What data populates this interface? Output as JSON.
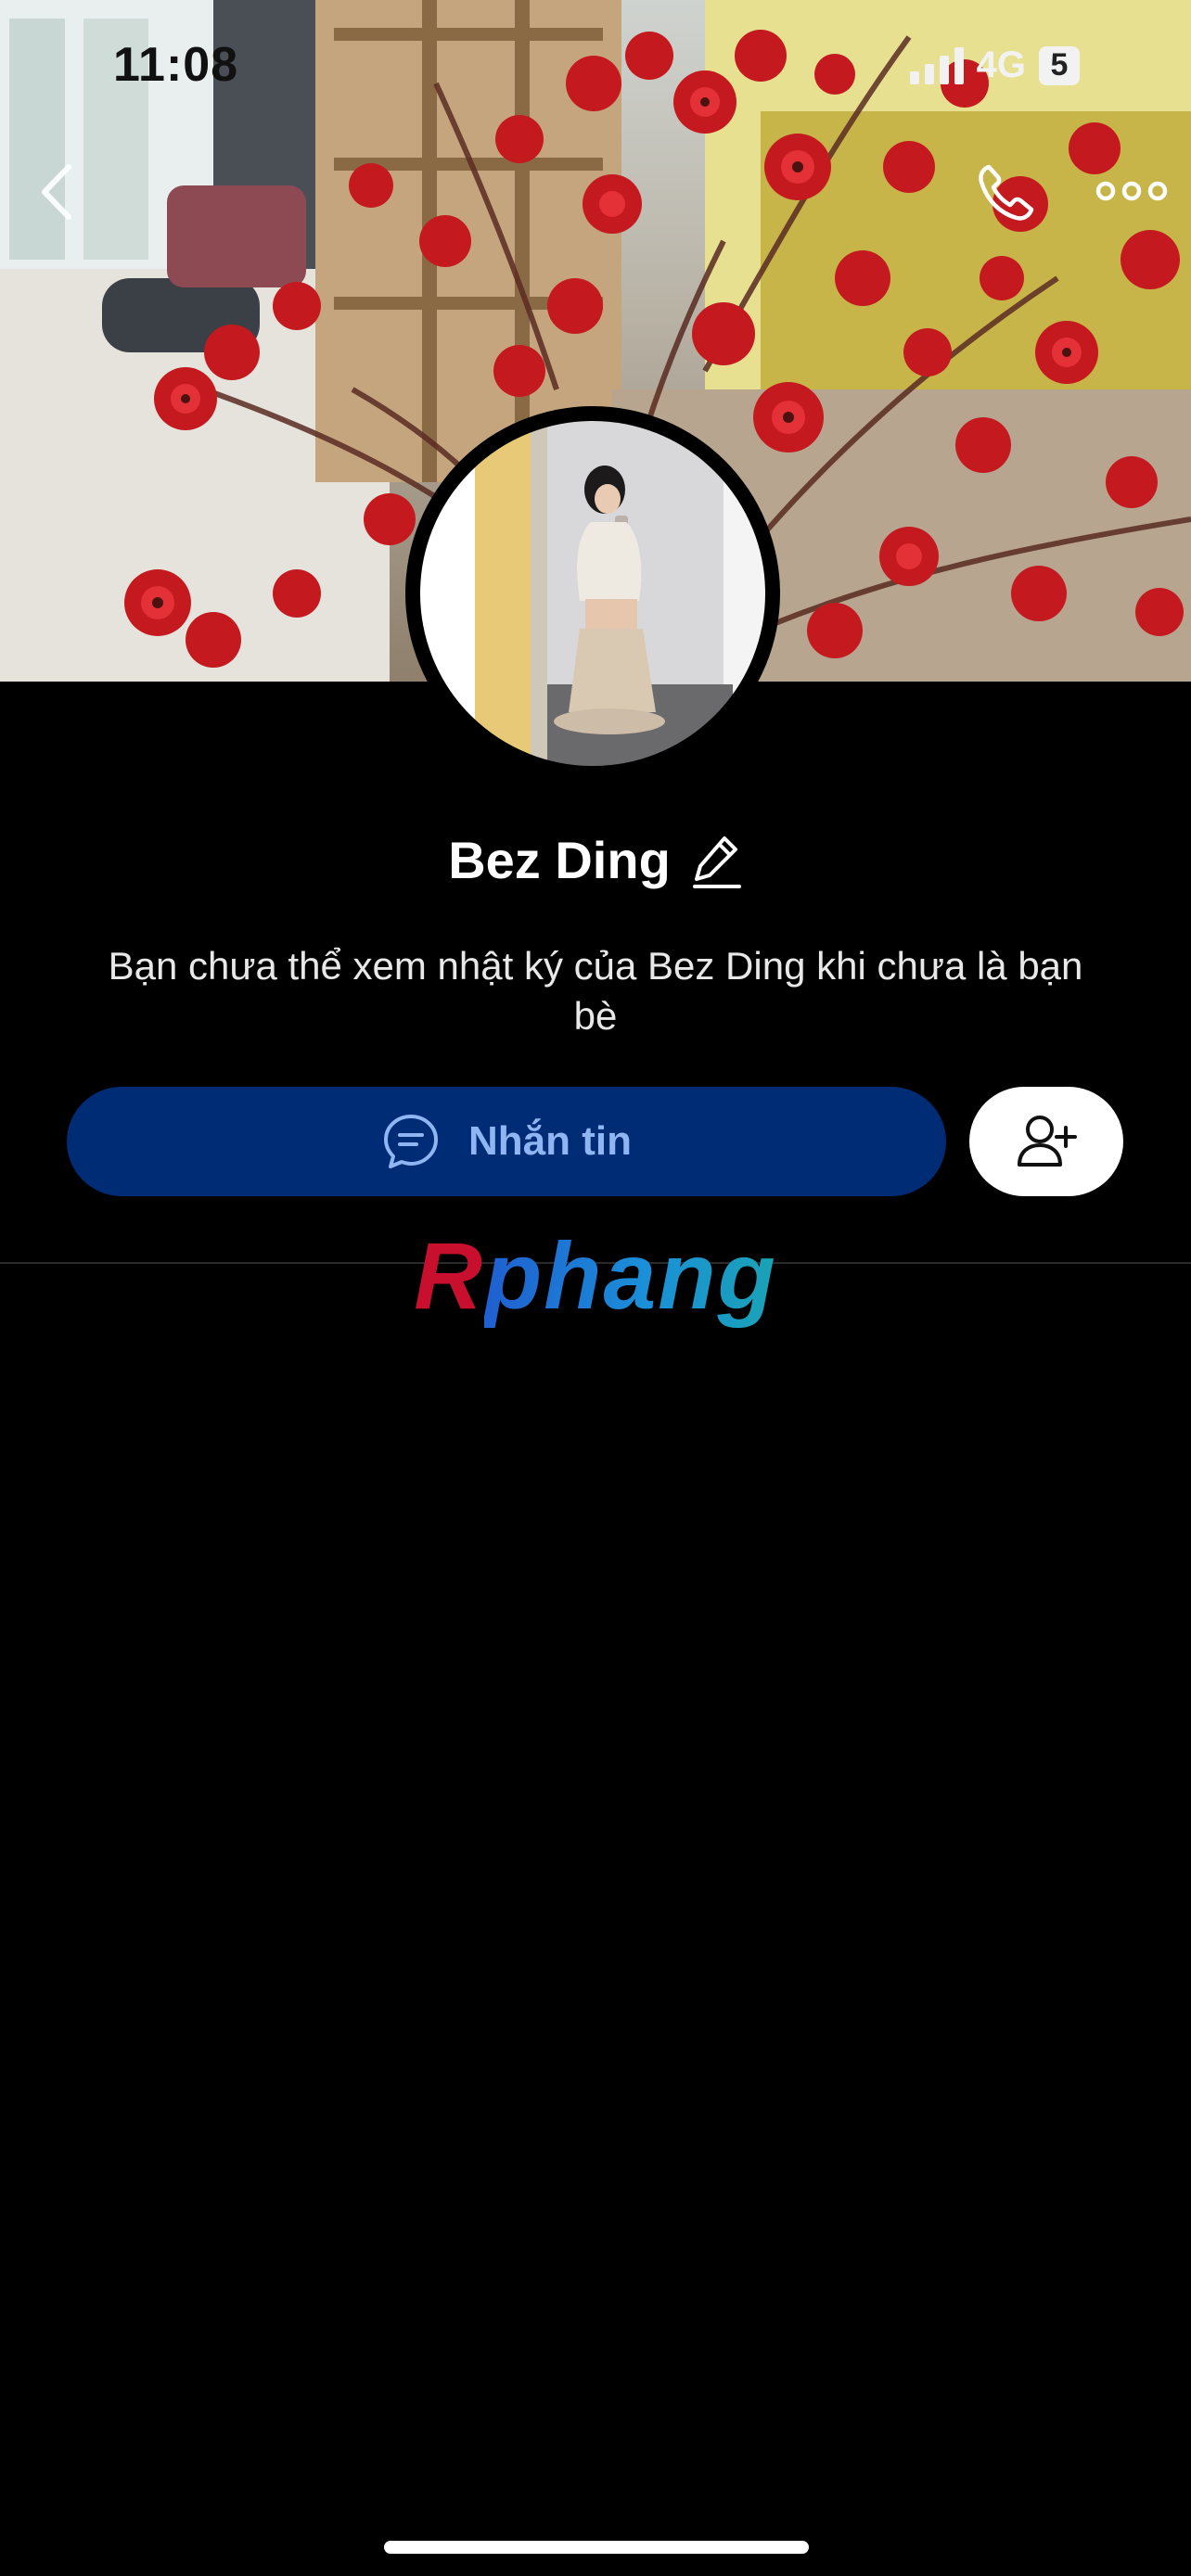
{
  "status_bar": {
    "time": "11:08",
    "network": "4G",
    "battery": "5"
  },
  "profile": {
    "name": "Bez Ding",
    "privacy_note": "Bạn chưa thể xem nhật ký của Bez Ding khi chưa là bạn bè"
  },
  "actions": {
    "message_label": "Nhắn tin"
  },
  "watermark": {
    "first_letter": "R",
    "rest": "phang"
  },
  "icons": {
    "back": "chevron-left-icon",
    "call": "phone-icon",
    "more": "more-dots-icon",
    "edit": "pencil-icon",
    "message": "chat-bubble-icon",
    "add_friend": "add-user-icon"
  },
  "colors": {
    "background": "#000000",
    "message_button": "#002c75",
    "message_label": "#8fb5f2",
    "add_friend_button": "#ffffff"
  }
}
